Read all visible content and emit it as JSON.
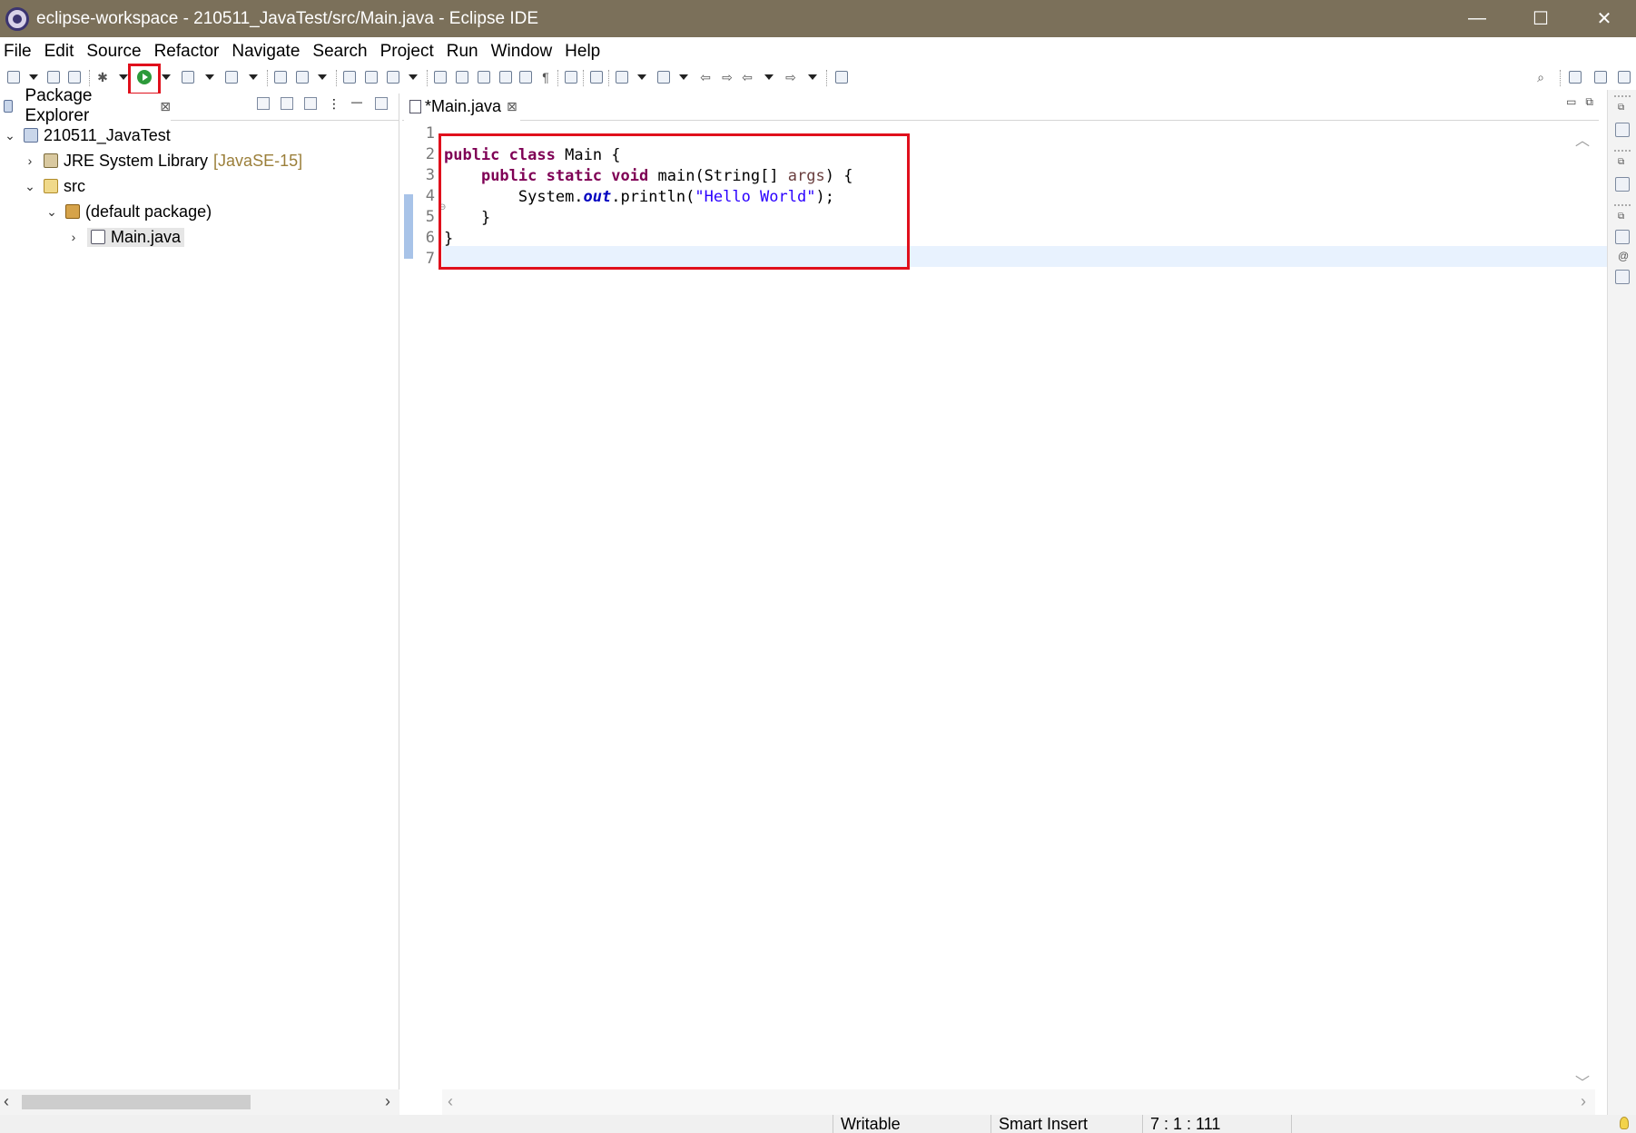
{
  "window": {
    "title": "eclipse-workspace - 210511_JavaTest/src/Main.java - Eclipse IDE",
    "minimize": "—",
    "maximize": "☐",
    "close": "✕"
  },
  "menu": [
    "File",
    "Edit",
    "Source",
    "Refactor",
    "Navigate",
    "Search",
    "Project",
    "Run",
    "Window",
    "Help"
  ],
  "toolbar": {
    "highlighted_button": "run-icon",
    "accent_color": "#e0101c"
  },
  "package_explorer": {
    "tab_label": "Package Explorer",
    "tree": {
      "project": "210511_JavaTest",
      "library": "JRE System Library",
      "library_version": "[JavaSE-15]",
      "src_folder": "src",
      "package": "(default package)",
      "file": "Main.java"
    }
  },
  "editor": {
    "tab_label": "*Main.java",
    "line_numbers": [
      "1",
      "2",
      "3",
      "4",
      "5",
      "6",
      "7"
    ],
    "code": {
      "l2_kw1": "public",
      "l2_kw2": "class",
      "l2_name": "Main {",
      "l3_kw1": "public",
      "l3_kw2": "static",
      "l3_kw3": "void",
      "l3_sig": "main(String[] ",
      "l3_param": "args",
      "l3_end": ") {",
      "l4_sys": "System.",
      "l4_field": "out",
      "l4_call": ".println(",
      "l4_str": "\"Hello World\"",
      "l4_end": ");",
      "l5": "}",
      "l6": "}"
    }
  },
  "status": {
    "writable": "Writable",
    "insert_mode": "Smart Insert",
    "position": "7 : 1 : 111"
  }
}
